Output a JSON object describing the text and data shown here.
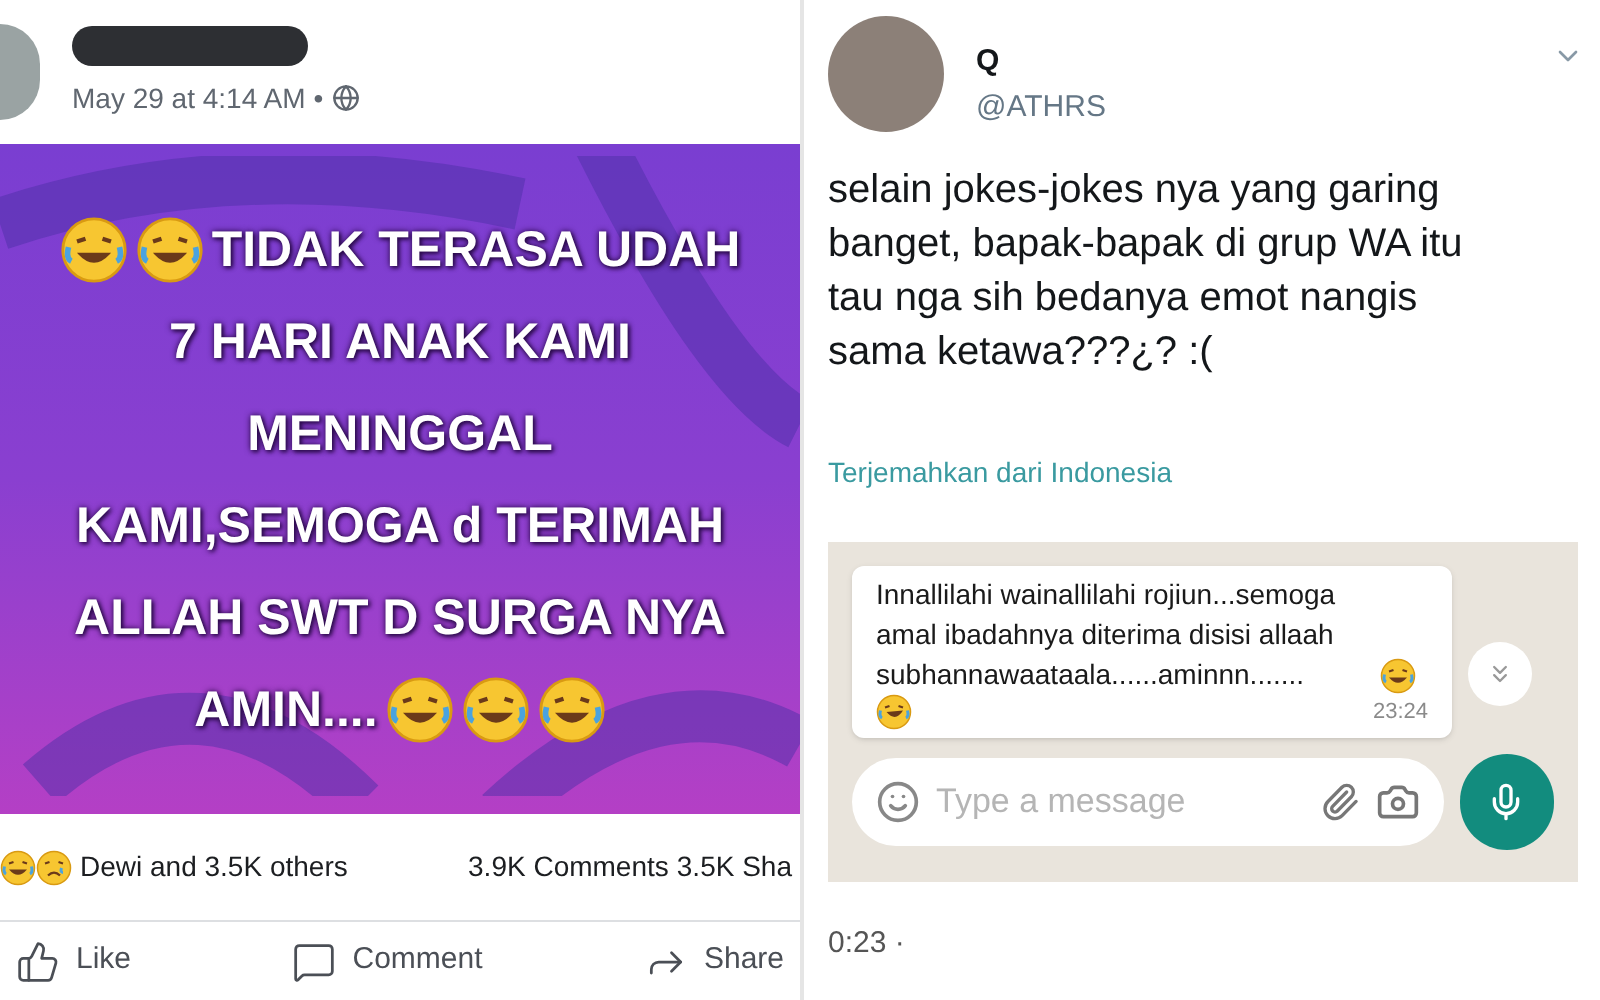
{
  "facebook_post": {
    "timestamp": "May 29 at 4:14 AM",
    "separator": "•",
    "image_lines": [
      {
        "text": "TIDAK TERASA UDAH",
        "kind": "emoji_before"
      },
      {
        "text": "7 HARI ANAK KAMI",
        "kind": "plain"
      },
      {
        "text": "MENINGGAL",
        "kind": "plain"
      },
      {
        "text": "KAMI,SEMOGA d TERIMAH",
        "kind": "plain"
      },
      {
        "text": "ALLAH SWT D SURGA NYA",
        "kind": "plain"
      },
      {
        "text": "AMIN....",
        "kind": "emoji_after"
      }
    ],
    "reactions_text": "Dewi and 3.5K others",
    "comments": "3.9K Comments",
    "shares": "3.5K Sha",
    "actions": [
      {
        "kind": "like",
        "label": "Like"
      },
      {
        "kind": "comment",
        "label": "Comment"
      },
      {
        "kind": "share",
        "label": "Share"
      }
    ]
  },
  "tweet": {
    "name": "Q",
    "handle": "@ATHRS",
    "text": "selain jokes-jokes nya yang garing banget, bapak-bapak di grup WA itu tau nga sih bedanya emot nangis sama ketawa???¿? :(",
    "translate": "Terjemahkan dari Indonesia",
    "chat": {
      "message": "Innallilahi wainallilahi rojiun...semoga amal ibadahnya diterima disisi allaah subhannawaataala......aminnn.......",
      "time": "23:24",
      "placeholder": "Type a message"
    },
    "video_time": "0:23 ·"
  }
}
